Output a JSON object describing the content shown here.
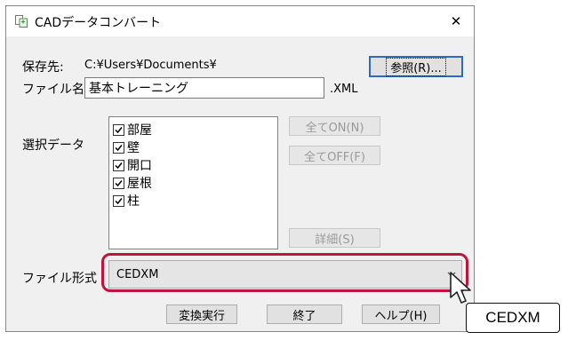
{
  "window": {
    "title": "CADデータコンバート",
    "close_symbol": "✕"
  },
  "destination": {
    "label": "保存先:",
    "path": "C:¥Users¥Documents¥",
    "browse_button": "参照(R)...",
    "browse_mnemonic": "R"
  },
  "filename": {
    "label": "ファイル名:",
    "value": "基本トレーニング",
    "extension": ".XML"
  },
  "selection": {
    "label": "選択データ",
    "items": [
      {
        "label": "部屋",
        "checked": true
      },
      {
        "label": "壁",
        "checked": true
      },
      {
        "label": "開口",
        "checked": true
      },
      {
        "label": "屋根",
        "checked": true
      },
      {
        "label": "柱",
        "checked": true
      }
    ],
    "all_on_button": "全てON(N)",
    "all_off_button": "全てOFF(F)",
    "detail_button": "詳細(S)"
  },
  "format": {
    "label": "ファイル形式",
    "selected": "CEDXM"
  },
  "actions": {
    "convert_button": "変換実行",
    "exit_button": "終了",
    "help_button": "ヘルプ(H)"
  },
  "annotation": {
    "callout_text": "CEDXM",
    "highlight_color": "#c0143c"
  }
}
